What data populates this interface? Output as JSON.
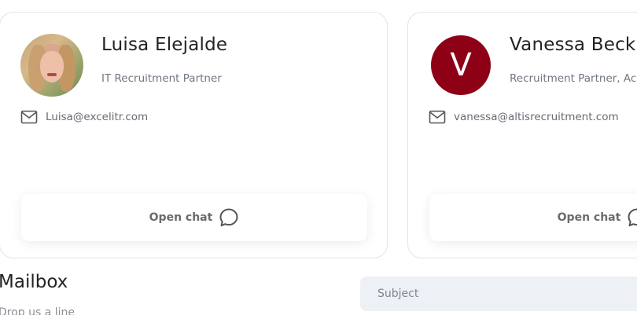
{
  "contacts": [
    {
      "name": "Luisa Elejalde",
      "role": "IT Recruitment Partner",
      "email": "Luisa@excelitr.com",
      "avatar": {
        "type": "photo"
      },
      "chat_label": "Open chat"
    },
    {
      "name": "Vanessa Beck",
      "role": "Recruitment Partner, Ac",
      "email": "vanessa@altisrecruitment.com",
      "avatar": {
        "type": "letter",
        "letter": "V",
        "color": "#8e0016"
      },
      "chat_label": "Open chat"
    }
  ],
  "icons": {
    "email": "envelope-icon",
    "chat": "chat-bubble-icon"
  },
  "mailbox": {
    "title": "Mailbox",
    "subtitle": "Drop us a line",
    "subject_placeholder": "Subject"
  }
}
